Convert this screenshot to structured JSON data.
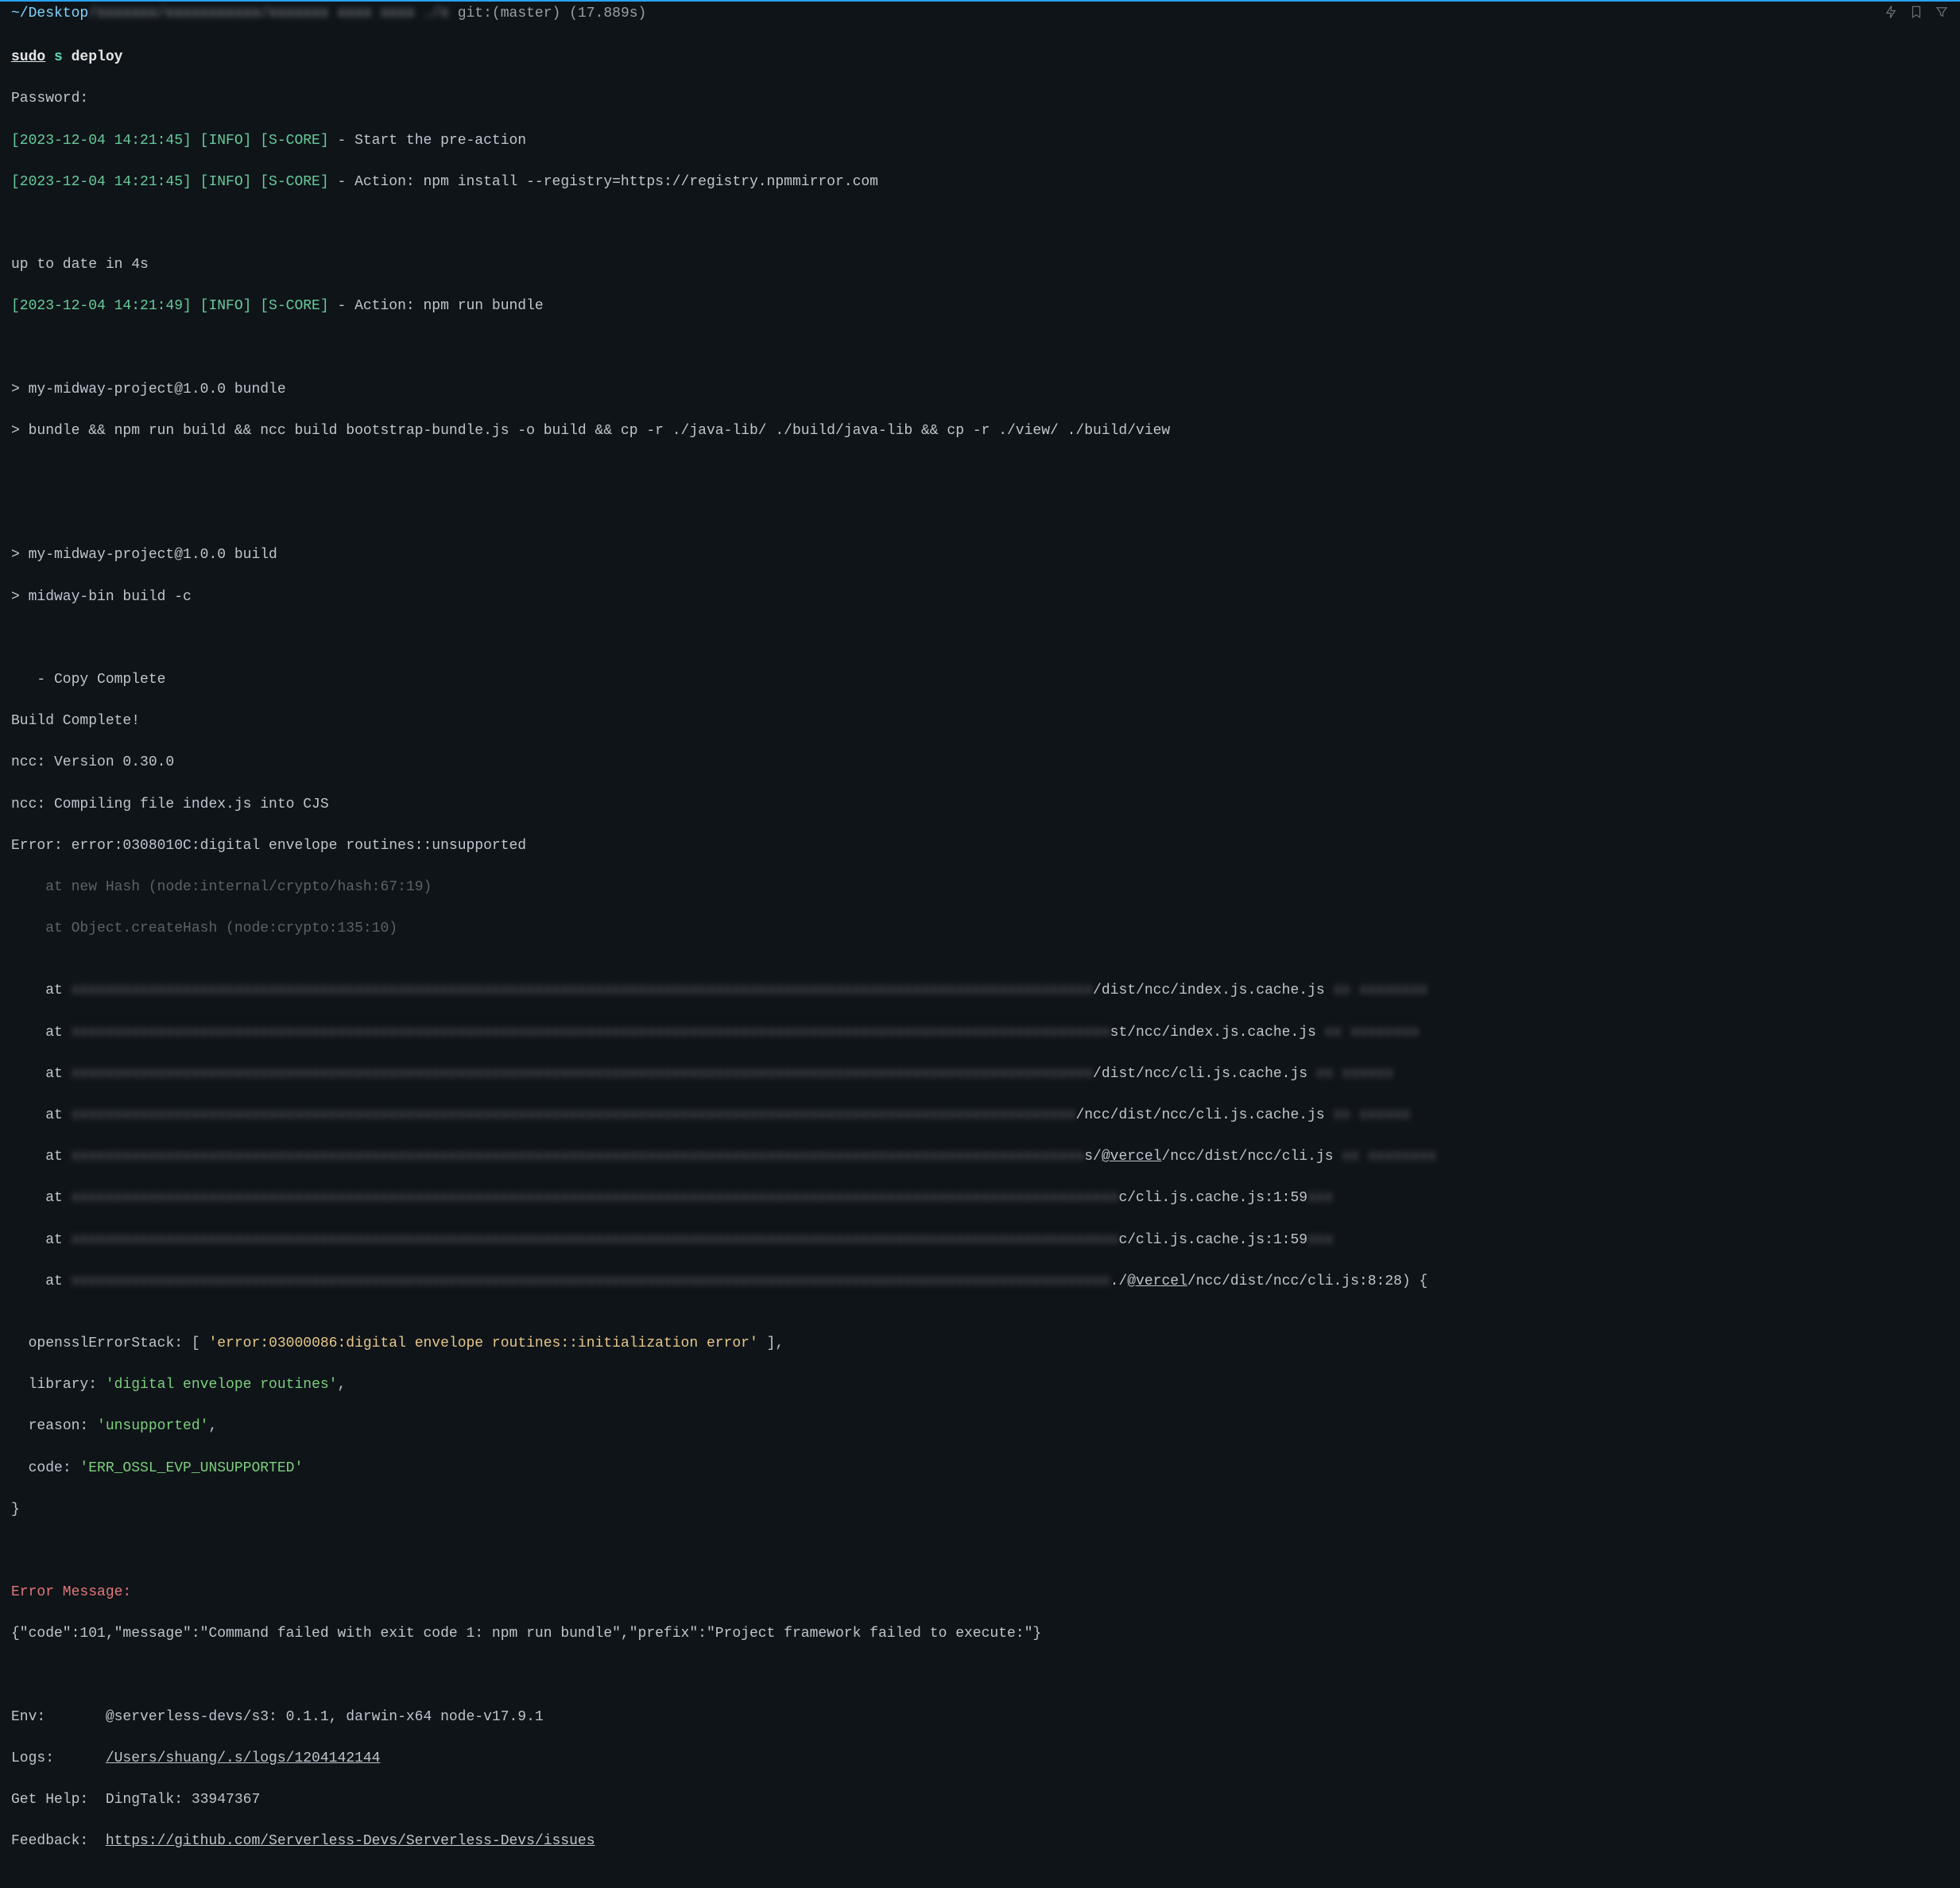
{
  "topbar": {
    "path_prefix": "~/Desktop",
    "git": " git:(master) (17.889s)"
  },
  "prompt": {
    "sudo": "sudo",
    "s": " s ",
    "deploy": "deploy"
  },
  "lines": {
    "password": "Password:",
    "info1_ts": "[2023-12-04 14:21:45] [INFO] [S-CORE]",
    "info1_msg": " - Start the pre-action",
    "info2_ts": "[2023-12-04 14:21:45] [INFO] [S-CORE]",
    "info2_msg": " - Action: npm install --registry=https://registry.npmmirror.com",
    "uptodate": "up to date in 4s",
    "info3_ts": "[2023-12-04 14:21:49] [INFO] [S-CORE]",
    "info3_msg": " - Action: npm run bundle",
    "bundle1": "> my-midway-project@1.0.0 bundle",
    "bundle2": "> bundle && npm run build && ncc build bootstrap-bundle.js -o build && cp -r ./java-lib/ ./build/java-lib && cp -r ./view/ ./build/view",
    "build1": "> my-midway-project@1.0.0 build",
    "build2": "> midway-bin build -c",
    "copy": "   - Copy Complete",
    "buildcomplete": "Build Complete!",
    "nccver": "ncc: Version 0.30.0",
    "ncccompile": "ncc: Compiling file index.js into CJS",
    "error": "Error: error:0308010C:digital envelope routines::unsupported",
    "trace1": "    at new Hash (node:internal/crypto/hash:67:19)",
    "trace2": "    at Object.createHash (node:crypto:135:10)",
    "st_at": "    at ",
    "st_tail_1": "/dist/ncc/index.js.cache.js",
    "st_tail_2": "st/ncc/index.js.cache.js",
    "st_tail_3": "/dist/ncc/cli.js.cache.js",
    "st_tail_4": "/ncc/dist/ncc/cli.js.cache.js",
    "st_tail_5a": "s/",
    "st_tail_5b": "@vercel",
    "st_tail_5c": "/ncc/dist/ncc/cli.js",
    "st_tail_6": "c/cli.js.cache.js:1:59",
    "st_tail_7": "c/cli.js.cache.js:1:59",
    "st_tail_8a": "./",
    "st_tail_8b": "@vercel",
    "st_tail_8c": "/ncc/dist/ncc/cli.js:8:28) {",
    "ossl_open": "  opensslErrorStack: [ ",
    "ossl_val": "'error:03000086:digital envelope routines::initialization error'",
    "ossl_close": " ],",
    "lib_open": "  library: ",
    "lib_val": "'digital envelope routines'",
    "lib_close": ",",
    "reason_open": "  reason: ",
    "reason_val": "'unsupported'",
    "reason_close": ",",
    "code_open": "  code: ",
    "code_val": "'ERR_OSSL_EVP_UNSUPPORTED'",
    "brace": "}",
    "err_label": "Error Message:",
    "err_json": "{\"code\":101,\"message\":\"Command failed with exit code 1: npm run bundle\",\"prefix\":\"Project framework failed to execute:\"}",
    "env_label": "Env:",
    "env_val": "@serverless-devs/s3: 0.1.1, darwin-x64 node-v17.9.1",
    "logs_label": "Logs:",
    "logs_val": "/Users/shuang/.s/logs/1204142144",
    "help_label": "Get Help:",
    "help_val": "DingTalk: 33947367",
    "fb_label": "Feedback:",
    "fb_val": "https://github.com/Serverless-Devs/Serverless-Devs/issues"
  }
}
